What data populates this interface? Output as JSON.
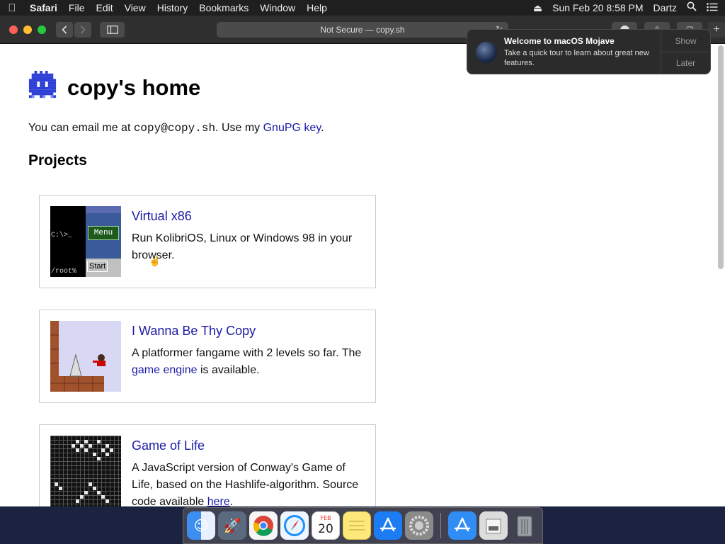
{
  "menubar": {
    "app": "Safari",
    "items": [
      "File",
      "Edit",
      "View",
      "History",
      "Bookmarks",
      "Window",
      "Help"
    ],
    "clock": "Sun Feb 20  8:58 PM",
    "user": "Dartz"
  },
  "toolbar": {
    "address": "Not Secure — copy.sh"
  },
  "notification": {
    "title": "Welcome to macOS Mojave",
    "body": "Take a quick tour to learn about great new features.",
    "show_label": "Show",
    "later_label": "Later"
  },
  "page": {
    "title": "copy's home",
    "intro_prefix": "You can email me at ",
    "email": "copy@copy.sh",
    "intro_mid": ". Use my ",
    "gpg_link": "GnuPG key",
    "intro_suffix": ".",
    "projects_heading": "Projects",
    "projects": [
      {
        "title": "Virtual x86",
        "desc": "Run KolibriOS, Linux or Windows 98 in your browser.",
        "thumb": {
          "prompt": "C:\\>_",
          "menu": "Menu",
          "start": "Start",
          "root": "/root%"
        }
      },
      {
        "title": "I Wanna Be Thy Copy",
        "desc_before": "A platformer fangame with 2 levels so far. The ",
        "desc_link": "game engine",
        "desc_after": " is available."
      },
      {
        "title": "Game of Life",
        "desc_before": "A JavaScript version of Conway's Game of Life, based on the Hashlife-algorithm. Source code available ",
        "desc_link": "here",
        "desc_after": "."
      }
    ]
  },
  "dock": {
    "calendar_month": "FEB",
    "calendar_day": "20"
  }
}
